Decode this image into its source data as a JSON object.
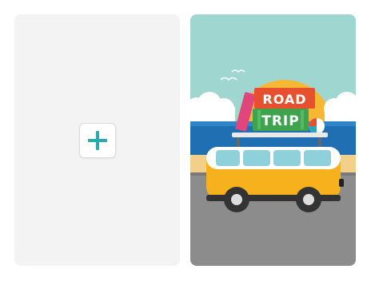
{
  "cards": [
    {
      "kind": "blank",
      "add_icon": "plus-icon",
      "accent": "#2aa7b8"
    },
    {
      "kind": "template-thumbnail",
      "sign": {
        "line1": "ROAD",
        "line2": "TRIP"
      },
      "colors": {
        "sky": "#9fd6cf",
        "sun": "#f7b733",
        "sea": "#1f6fb2",
        "sand": "#f2d08a",
        "road": "#8c8c8c",
        "van": "#f7b11c",
        "sign_top": "#e6502f",
        "sign_bottom": "#3fa34d"
      }
    }
  ]
}
